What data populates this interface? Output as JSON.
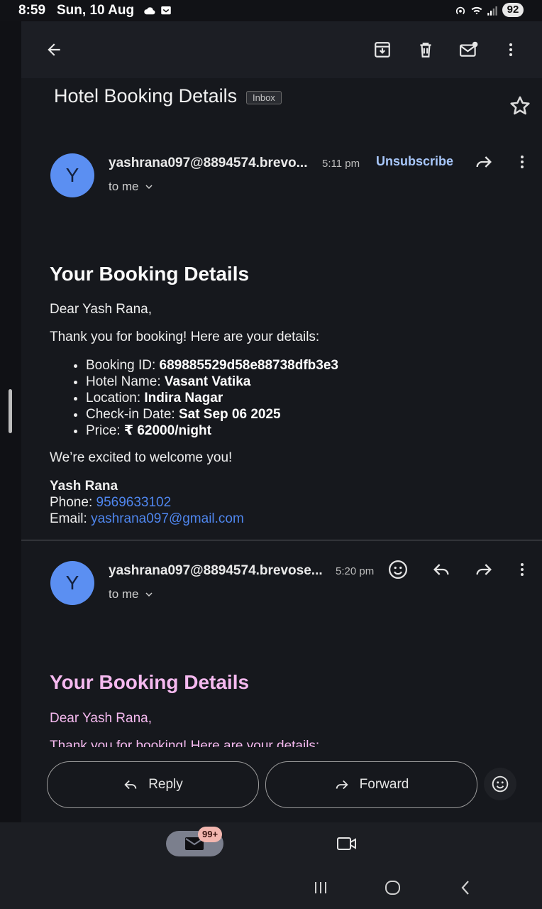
{
  "status": {
    "time": "8:59",
    "date": "Sun, 10 Aug",
    "battery": "92"
  },
  "subject": {
    "title": "Hotel Booking Details",
    "label": "Inbox"
  },
  "message1": {
    "avatar_letter": "Y",
    "sender": "yashrana097@8894574.brevo...",
    "time": "5:11 pm",
    "to": "to me",
    "unsubscribe": "Unsubscribe",
    "heading": "Your Booking Details",
    "greeting": "Dear Yash Rana,",
    "intro": "Thank you for booking! Here are your details:",
    "details": [
      {
        "label": "Booking ID: ",
        "value": "689885529d58e88738dfb3e3"
      },
      {
        "label": "Hotel Name: ",
        "value": "Vasant Vatika"
      },
      {
        "label": "Location: ",
        "value": "Indira Nagar"
      },
      {
        "label": "Check-in Date: ",
        "value": "Sat Sep 06 2025"
      },
      {
        "label": "Price: ",
        "value": "₹ 62000/night"
      }
    ],
    "closing": "We’re excited to welcome you!",
    "signature_name": "Yash Rana",
    "phone_label": "Phone: ",
    "phone": "9569633102",
    "email_label": "Email: ",
    "email": "yashrana097@gmail.com"
  },
  "message2": {
    "avatar_letter": "Y",
    "sender": "yashrana097@8894574.brevose...",
    "time": "5:20 pm",
    "to": "to me",
    "heading": "Your Booking Details",
    "greeting": "Dear Yash Rana,",
    "intro": "Thank you for booking! Here are your details:"
  },
  "actions": {
    "reply": "Reply",
    "forward": "Forward"
  },
  "bottom_nav": {
    "mail_badge": "99+"
  },
  "colors": {
    "background": "#16181d",
    "accent": "#a8c7fa",
    "link": "#4f86ee",
    "avatar": "#5b8ff2",
    "pink_text": "#f5b9ef"
  }
}
